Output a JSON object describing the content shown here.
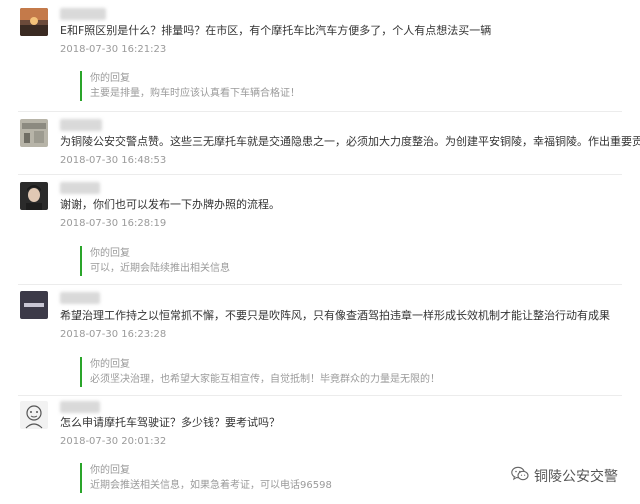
{
  "comments": [
    {
      "avatar_icon": "sunset-avatar-icon",
      "text": "E和F照区别是什么？排量吗？在市区，有个摩托车比汽车方便多了，个人有点想法买一辆",
      "time": "2018-07-30 16:21:23",
      "reply": {
        "label": "你的回复",
        "text": "主要是排量，购车时应该认真看下车辆合格证！"
      }
    },
    {
      "avatar_icon": "street-photo-avatar-icon",
      "text": "为铜陵公安交警点赞。这些三无摩托车就是交通隐患之一，必须加大力度整治。为创建平安铜陵，幸福铜陵。作出重要贡献。",
      "time": "2018-07-30 16:48:53"
    },
    {
      "avatar_icon": "portrait-avatar-icon",
      "text": "谢谢，你们也可以发布一下办牌办照的流程。",
      "time": "2018-07-30 16:28:19",
      "reply": {
        "label": "你的回复",
        "text": "可以，近期会陆续推出相关信息"
      }
    },
    {
      "avatar_icon": "dark-logo-avatar-icon",
      "text": "希望治理工作持之以恒常抓不懈，不要只是吹阵风，只有像查酒驾拍违章一样形成长效机制才能让整治行动有成果",
      "time": "2018-07-30 16:23:28",
      "reply": {
        "label": "你的回复",
        "text": "必须坚决治理，也希望大家能互相宣传，自觉抵制！毕竟群众的力量是无限的！"
      }
    },
    {
      "avatar_icon": "sketch-face-avatar-icon",
      "text": "怎么申请摩托车驾驶证？多少钱？要考试吗？",
      "time": "2018-07-30 20:01:32",
      "reply": {
        "label": "你的回复",
        "text": "近期会推送相关信息，如果急着考证，可以电话96598"
      }
    }
  ],
  "watermark": {
    "icon": "wechat-icon",
    "text": "铜陵公安交警"
  }
}
